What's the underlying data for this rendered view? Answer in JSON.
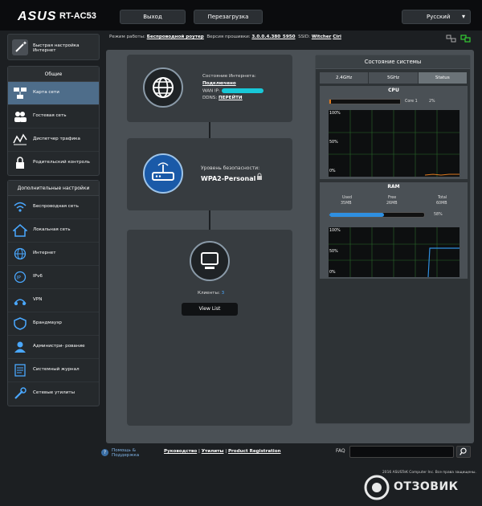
{
  "header": {
    "logo": "ASUS",
    "model": "RT-AC53",
    "exit_label": "Выход",
    "reboot_label": "Перезагрузка",
    "language": "Русский"
  },
  "infobar": {
    "mode_label": "Режим работы:",
    "mode_value": "Беспроводной роутер",
    "fw_label": "Версия прошивки:",
    "fw_value": "3.0.0.4.380_5950",
    "ssid_label": "SSID:",
    "ssid_1": "Witcher",
    "ssid_2": "Ciri"
  },
  "sidebar": {
    "quick_label": "Быстрая настройка Интернет",
    "general_header": "Общие",
    "general_items": [
      {
        "label": "Карта сети",
        "icon": "network-map-icon",
        "active": true
      },
      {
        "label": "Гостевая сеть",
        "icon": "guest-network-icon"
      },
      {
        "label": "Диспетчер трафика",
        "icon": "traffic-icon"
      },
      {
        "label": "Родительский контроль",
        "icon": "lock-icon"
      }
    ],
    "advanced_header": "Дополнительные настройки",
    "advanced_items": [
      {
        "label": "Беспроводная сеть",
        "icon": "wireless-icon"
      },
      {
        "label": "Локальная сеть",
        "icon": "home-icon"
      },
      {
        "label": "Интернет",
        "icon": "globe-icon"
      },
      {
        "label": "IPv6",
        "icon": "ipv6-icon"
      },
      {
        "label": "VPN",
        "icon": "vpn-icon"
      },
      {
        "label": "Брандмауэр",
        "icon": "firewall-icon"
      },
      {
        "label": "Администри- рование",
        "icon": "admin-icon"
      },
      {
        "label": "Системный журнал",
        "icon": "log-icon"
      },
      {
        "label": "Сетевые утилиты",
        "icon": "tools-icon"
      }
    ]
  },
  "internet_card": {
    "status_label": "Состояние Интернета:",
    "status_value": "Подключено",
    "wan_label": "WAN IP:",
    "ddns_label": "DDNS:",
    "ddns_link": "ПЕРЕЙТИ"
  },
  "security_card": {
    "level_label": "Уровень безопасности:",
    "level_value": "WPA2-Personal"
  },
  "clients_card": {
    "clients_label": "Клиенты:",
    "clients_count": "3",
    "view_list": "View List"
  },
  "system_status": {
    "title": "Состояние системы",
    "tabs": [
      "2.4GHz",
      "5GHz",
      "Status"
    ],
    "active_tab": "Status",
    "cpu": {
      "title": "CPU",
      "core_label": "Core 1",
      "core_percent": "2%",
      "core_fraction": 0.02,
      "graph_labels": [
        "100%",
        "50%",
        "0%"
      ]
    },
    "ram": {
      "title": "RAM",
      "used_label": "Used",
      "used_value": "35MB",
      "free_label": "Free",
      "free_value": "26MB",
      "total_label": "Total",
      "total_value": "60MB",
      "percent": "58%",
      "fraction": 0.58,
      "graph_labels": [
        "100%",
        "50%",
        "0%"
      ]
    }
  },
  "footer": {
    "help_label": "Помощь & Поддержка",
    "links": [
      "Руководство",
      "Утилиты",
      "Product Registration"
    ],
    "faq_label": "FAQ",
    "copyright": "2016 ASUSTeK Computer Inc. Все права защищены."
  },
  "watermark": {
    "text": "ОТЗОВИК"
  },
  "colors": {
    "accent_blue": "#1a5aa8",
    "active_item": "#4e6d8a",
    "cpu_bar": "#e07a1f",
    "ram_bar": "#2f8fe0",
    "graph_line": "#2f8fe0"
  }
}
